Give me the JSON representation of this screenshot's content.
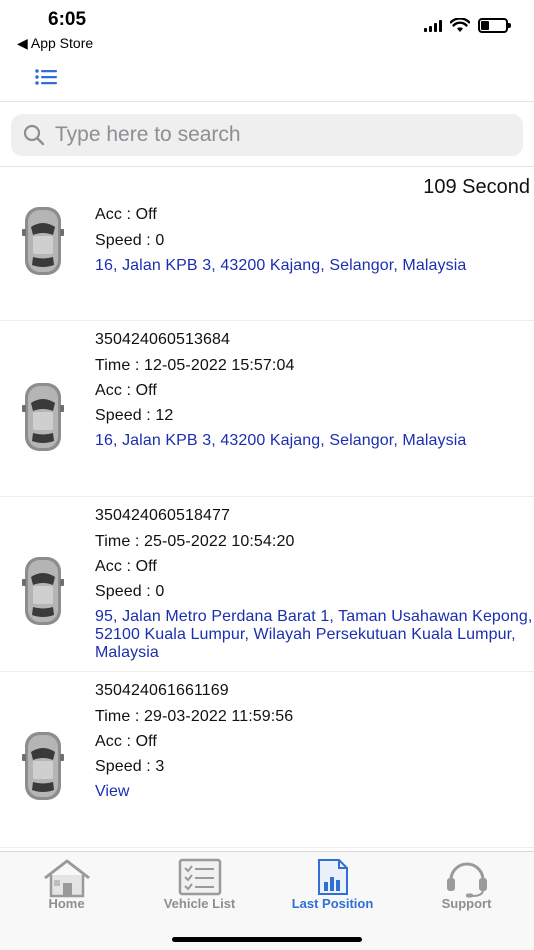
{
  "status_bar": {
    "time": "6:05",
    "back_label": "◀ App Store",
    "battery_level": 0.35
  },
  "header": {
    "menu_icon": "list-icon",
    "accent_color": "#2f6fd6"
  },
  "search": {
    "placeholder": "Type here to search",
    "value": ""
  },
  "list": {
    "refresh_countdown": "109 Second",
    "items": [
      {
        "acc": "Acc : Off",
        "speed": "Speed : 0",
        "address": "16, Jalan KPB 3, 43200 Kajang, Selangor, Malaysia"
      },
      {
        "imei": "350424060513684",
        "time": "Time : 12-05-2022 15:57:04",
        "acc": "Acc : Off",
        "speed": "Speed : 12",
        "address": "16, Jalan KPB 3, 43200 Kajang, Selangor, Malaysia"
      },
      {
        "imei": "350424060518477",
        "time": "Time : 25-05-2022 10:54:20",
        "acc": "Acc : Off",
        "speed": "Speed : 0",
        "address": "95, Jalan Metro Perdana Barat 1, Taman Usahawan Kepong, 52100 Kuala Lumpur, Wilayah Persekutuan Kuala Lumpur, Malaysia"
      },
      {
        "imei": "350424061661169",
        "time": "Time : 29-03-2022 11:59:56",
        "acc": "Acc : Off",
        "speed": "Speed : 3",
        "view_label": "View"
      }
    ]
  },
  "tabs": [
    {
      "label": "Home",
      "icon": "home-icon",
      "active": false
    },
    {
      "label": "Vehicle List",
      "icon": "checklist-icon",
      "active": false
    },
    {
      "label": "Last Position",
      "icon": "report-chart-icon",
      "active": true
    },
    {
      "label": "Support",
      "icon": "headset-icon",
      "active": false
    }
  ]
}
